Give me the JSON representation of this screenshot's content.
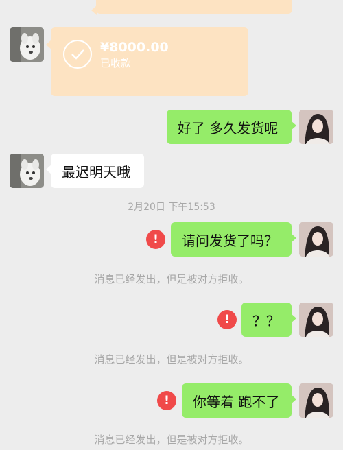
{
  "messages": {
    "transfer": {
      "amount": "¥8000.00",
      "status": "已收款"
    },
    "m1_right": "好了 多久发货呢",
    "m2_left": "最迟明天哦",
    "timestamp": "2月20日 下午15:53",
    "m3_right": "请问发货了吗？",
    "notice1": "消息已经发出，但是被对方拒收。",
    "m4_right": "？？",
    "notice2": "消息已经发出，但是被对方拒收。",
    "m5_right": "你等着 跑不了",
    "notice3": "消息已经发出，但是被对方拒收。",
    "error_symbol": "!"
  },
  "colors": {
    "background": "#ededed",
    "bubble_sent": "#95ec69",
    "bubble_received": "#ffffff",
    "transfer_card": "#fde3c2",
    "error_red": "#f04a4a",
    "system_text": "#a8a8a8"
  },
  "icons": {
    "transfer_status": "checkmark-circle-icon",
    "failed_message": "exclamation-error-icon"
  }
}
